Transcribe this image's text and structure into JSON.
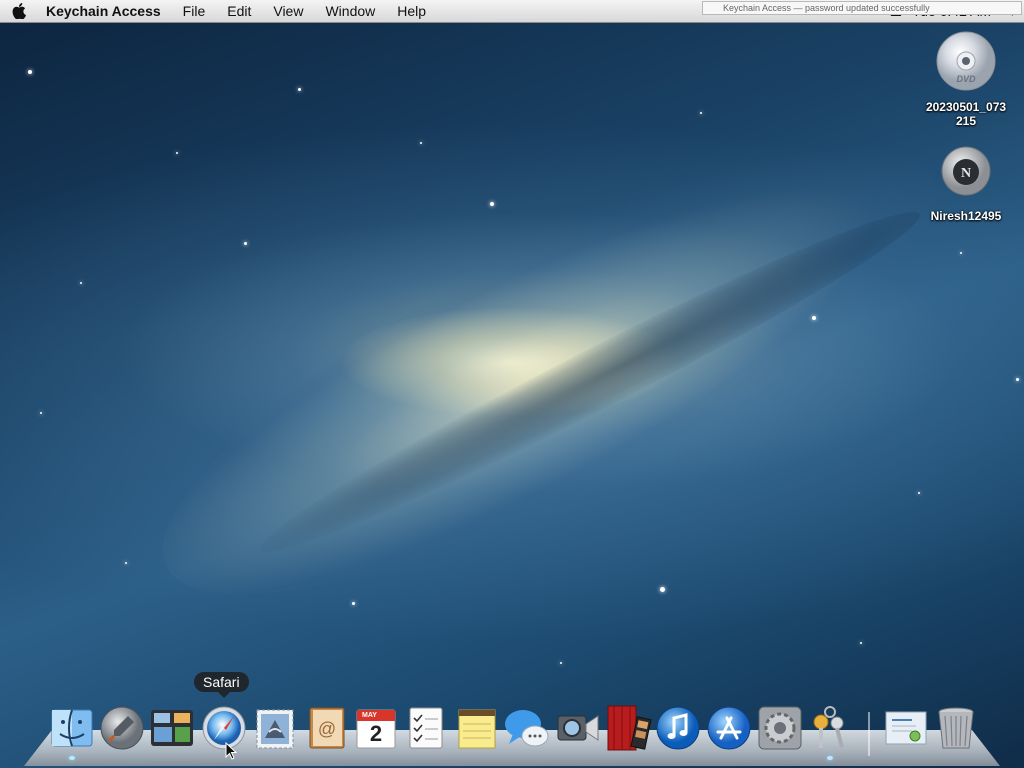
{
  "menubar": {
    "apple_icon": "apple-logo-icon",
    "app_name": "Keychain Access",
    "menus": [
      "File",
      "Edit",
      "View",
      "Window",
      "Help"
    ],
    "clock": "Tue 6:42 AM",
    "notification_text": "Keychain Access — password updated successfully"
  },
  "desktop_icons": [
    {
      "label": "20230501_073215",
      "icon": "dvd-disc-icon"
    },
    {
      "label": "Niresh12495",
      "icon": "hard-disk-icon"
    }
  ],
  "dock": {
    "tooltip": "Safari",
    "items": [
      {
        "name": "Finder",
        "icon": "finder-icon",
        "running": true
      },
      {
        "name": "Launchpad",
        "icon": "launchpad-icon",
        "running": false
      },
      {
        "name": "Mission Control",
        "icon": "mission-control-icon",
        "running": false
      },
      {
        "name": "Safari",
        "icon": "safari-icon",
        "running": false
      },
      {
        "name": "Mail",
        "icon": "mail-icon",
        "running": false
      },
      {
        "name": "Contacts",
        "icon": "contacts-icon",
        "running": false
      },
      {
        "name": "Calendar",
        "icon": "calendar-icon",
        "running": false,
        "month": "MAY",
        "day": "2"
      },
      {
        "name": "Reminders",
        "icon": "reminders-icon",
        "running": false
      },
      {
        "name": "Notes",
        "icon": "notes-icon",
        "running": false
      },
      {
        "name": "Messages",
        "icon": "messages-icon",
        "running": false
      },
      {
        "name": "FaceTime",
        "icon": "facetime-icon",
        "running": false
      },
      {
        "name": "Photo Booth",
        "icon": "photo-booth-icon",
        "running": false
      },
      {
        "name": "iTunes",
        "icon": "itunes-icon",
        "running": false
      },
      {
        "name": "App Store",
        "icon": "app-store-icon",
        "running": false
      },
      {
        "name": "System Preferences",
        "icon": "system-preferences-icon",
        "running": false
      },
      {
        "name": "Keychain Access",
        "icon": "keychain-access-icon",
        "running": true
      },
      {
        "name": "Certificate",
        "icon": "certificate-document-icon",
        "running": false
      },
      {
        "name": "Trash",
        "icon": "trash-icon",
        "running": false
      }
    ]
  },
  "colors": {
    "menubar_top": "#f4f4f4",
    "menubar_bottom": "#d8d8d8",
    "sky_dark": "#0d2540",
    "sky_mid": "#2c5f88",
    "galaxy_core": "#fff8d2"
  }
}
